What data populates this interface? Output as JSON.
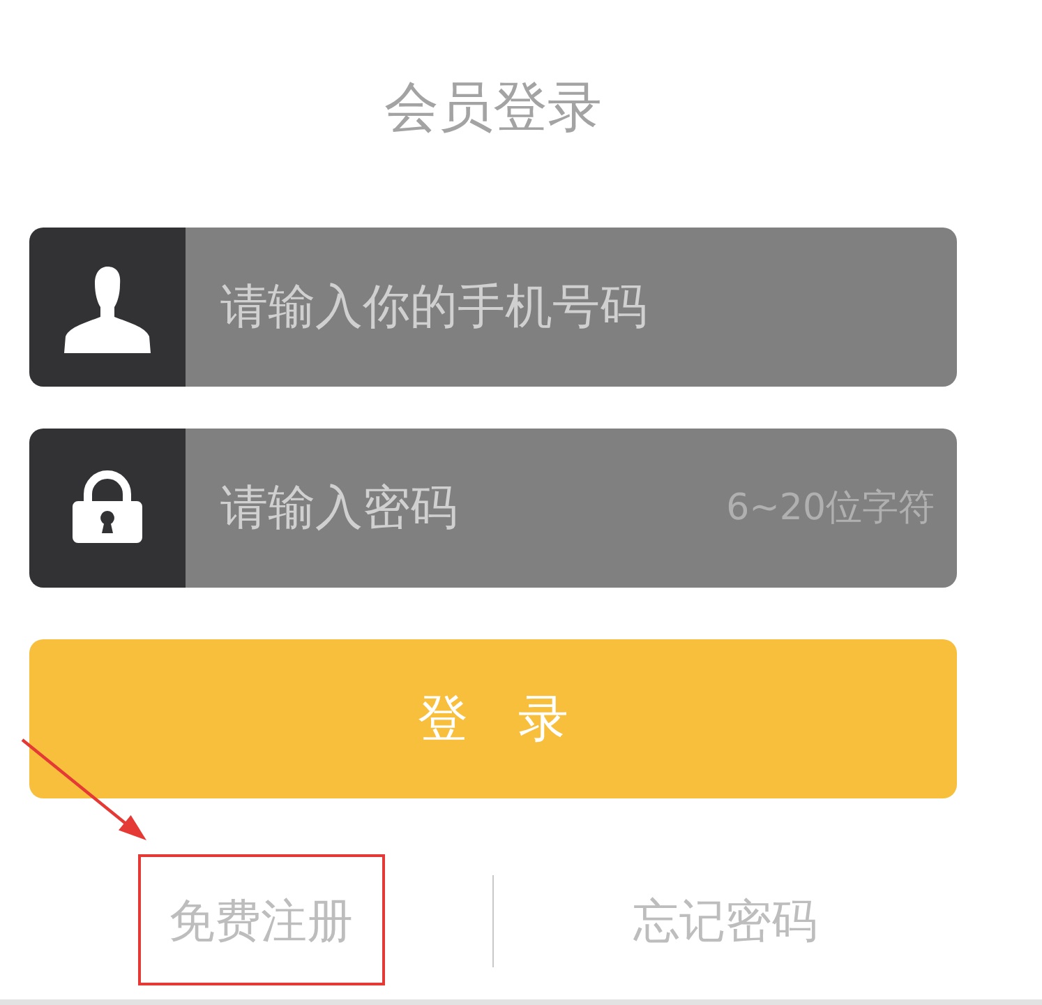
{
  "title": "会员登录",
  "fields": [
    {
      "kind": "phone",
      "placeholder": "请输入你的手机号码"
    },
    {
      "kind": "password",
      "placeholder": "请输入密码",
      "hint": "6~20位字符"
    }
  ],
  "login_button": "登　录",
  "links": [
    {
      "label": "免费注册",
      "highlighted": true
    },
    {
      "label": "忘记密码",
      "highlighted": false
    }
  ]
}
